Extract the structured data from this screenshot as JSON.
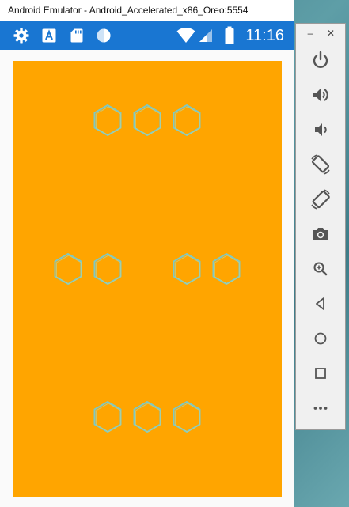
{
  "window": {
    "title": "Android Emulator - Android_Accelerated_x86_Oreo:5554"
  },
  "statusbar": {
    "time": "11:16",
    "color": "#1976d2",
    "left_icons": [
      "settings-icon",
      "app-a-icon",
      "sd-card-icon",
      "sync-icon"
    ],
    "right_icons": [
      "wifi-icon",
      "cell-signal-icon",
      "battery-icon"
    ]
  },
  "app": {
    "canvas_color": "#ffa500",
    "hexagon_outline_color": "#7ec9c4",
    "hexagon_rows": [
      {
        "count": 3,
        "pattern": "three centered"
      },
      {
        "count": 4,
        "pattern": "two pairs with gap"
      },
      {
        "count": 3,
        "pattern": "three centered"
      }
    ]
  },
  "control_panel": {
    "minimize_label": "–",
    "close_label": "✕",
    "buttons": [
      "power-icon",
      "volume-up-icon",
      "volume-down-icon",
      "rotate-left-icon",
      "rotate-right-icon",
      "camera-icon",
      "zoom-icon",
      "back-icon",
      "home-icon",
      "overview-icon",
      "more-icon"
    ]
  }
}
